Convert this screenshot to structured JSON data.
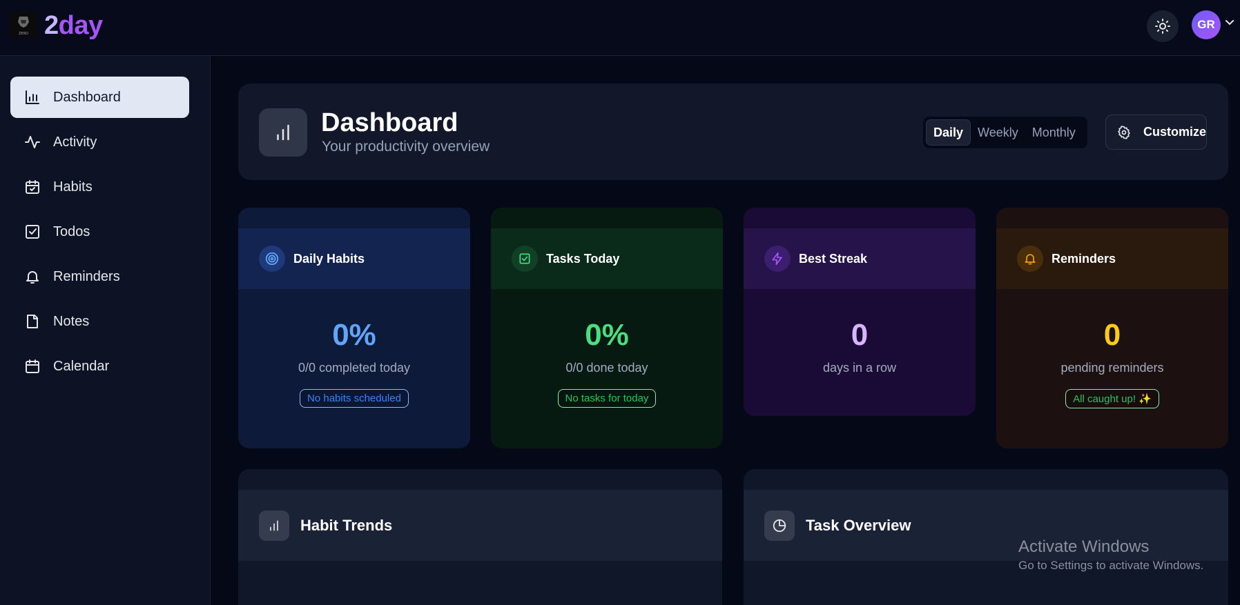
{
  "app": {
    "logo_text_a": "2",
    "logo_text_b": "day",
    "logo_img_text": "ZERO",
    "avatar_initials": "GR",
    "icons": {
      "theme": "sun-icon",
      "caret": "chevron-down-icon"
    }
  },
  "sidebar": {
    "items": [
      {
        "label": "Dashboard",
        "icon": "bar-chart-icon",
        "active": true
      },
      {
        "label": "Activity",
        "icon": "activity-icon",
        "active": false
      },
      {
        "label": "Habits",
        "icon": "calendar-check-icon",
        "active": false
      },
      {
        "label": "Todos",
        "icon": "checkbox-icon",
        "active": false
      },
      {
        "label": "Reminders",
        "icon": "bell-icon",
        "active": false
      },
      {
        "label": "Notes",
        "icon": "file-icon",
        "active": false
      },
      {
        "label": "Calendar",
        "icon": "calendar-icon",
        "active": false
      }
    ]
  },
  "header": {
    "title": "Dashboard",
    "subtitle": "Your productivity overview",
    "period_tabs": [
      "Daily",
      "Weekly",
      "Monthly"
    ],
    "active_period": "Daily",
    "customize_label": "Customize"
  },
  "stats": [
    {
      "label": "Daily Habits",
      "value": "0%",
      "desc": "0/0 completed today",
      "badge": "No habits scheduled",
      "icon": "target-icon",
      "accent": "#60a5fa",
      "badge_color": "#3b82f6"
    },
    {
      "label": "Tasks Today",
      "value": "0%",
      "desc": "0/0 done today",
      "badge": "No tasks for today",
      "icon": "check-square-icon",
      "accent": "#4ade80",
      "badge_color": "#22c55e"
    },
    {
      "label": "Best Streak",
      "value": "0",
      "desc": "days in a row",
      "badge": "",
      "icon": "lightning-icon",
      "accent": "#d8b4fe",
      "badge_color": ""
    },
    {
      "label": "Reminders",
      "value": "0",
      "desc": "pending reminders",
      "badge": "All caught up! ✨",
      "icon": "bell-icon",
      "accent": "#facc15",
      "badge_color": "#22c55e"
    }
  ],
  "panels": [
    {
      "title": "Habit Trends",
      "icon": "bar-chart-icon"
    },
    {
      "title": "Task Overview",
      "icon": "pie-chart-icon"
    }
  ],
  "watermark": {
    "title": "Activate Windows",
    "subtitle": "Go to Settings to activate Windows."
  }
}
